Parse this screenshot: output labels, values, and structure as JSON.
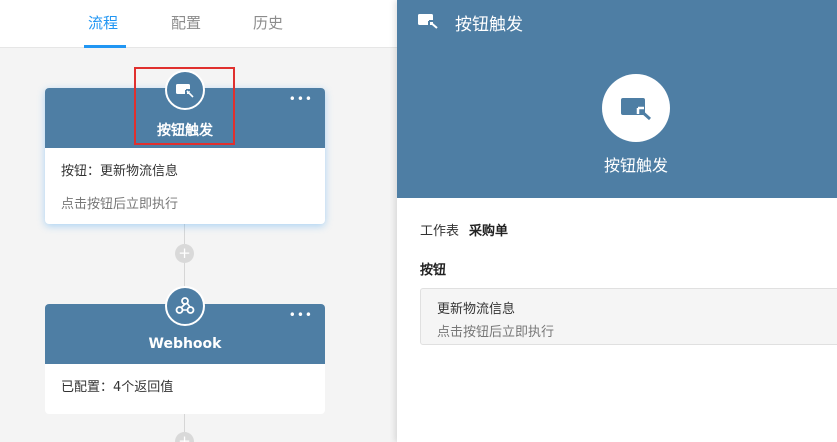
{
  "tabs": [
    {
      "label": "流程",
      "active": true
    },
    {
      "label": "配置",
      "active": false
    },
    {
      "label": "历史",
      "active": false
    }
  ],
  "nodes": [
    {
      "title": "按钮触发",
      "more": "•••",
      "icon": "button-trigger-icon",
      "body_line1": "按钮：更新物流信息",
      "body_line2": "点击按钮后立即执行"
    },
    {
      "title": "Webhook",
      "more": "•••",
      "icon": "webhook-icon",
      "body_line1": "已配置：4个返回值"
    }
  ],
  "panel": {
    "title": "按钮触发",
    "big_title": "按钮触发",
    "worksheet_label": "工作表",
    "worksheet_value": "采购单",
    "button_section_label": "按钮",
    "button_name": "更新物流信息",
    "button_desc": "点击按钮后立即执行"
  },
  "colors": {
    "accent": "#2196f3",
    "node_header": "#4e7ea4",
    "highlight": "#e0302e"
  }
}
